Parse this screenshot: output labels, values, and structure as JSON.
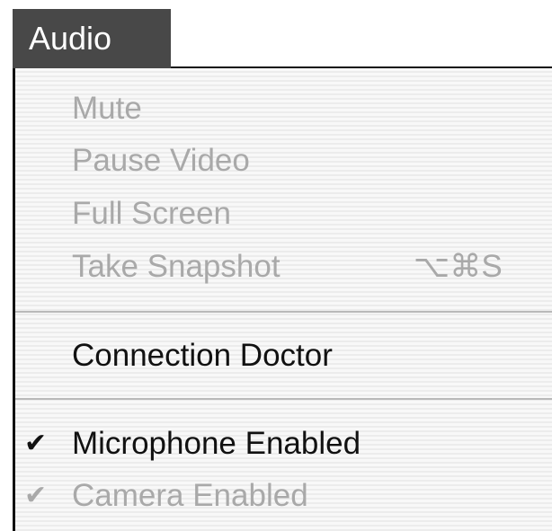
{
  "menubar": {
    "title": "Audio"
  },
  "menu": {
    "group1": [
      {
        "label": "Mute",
        "shortcut": "",
        "enabled": false,
        "checked": false
      },
      {
        "label": "Pause Video",
        "shortcut": "",
        "enabled": false,
        "checked": false
      },
      {
        "label": "Full Screen",
        "shortcut": "",
        "enabled": false,
        "checked": false
      },
      {
        "label": "Take Snapshot",
        "shortcut": "⌥⌘S",
        "enabled": false,
        "checked": false
      }
    ],
    "group2": [
      {
        "label": "Connection Doctor",
        "enabled": true,
        "checked": false
      }
    ],
    "group3": [
      {
        "label": "Microphone Enabled",
        "enabled": true,
        "checked": true,
        "check_glyph": "✔"
      },
      {
        "label": "Camera Enabled",
        "enabled": false,
        "checked": true,
        "check_glyph": "✔"
      }
    ]
  },
  "colors": {
    "title_background": "#484848",
    "disabled_text": "#a9a9a9",
    "enabled_text": "#111111",
    "menu_background": "#f6f6f6"
  }
}
